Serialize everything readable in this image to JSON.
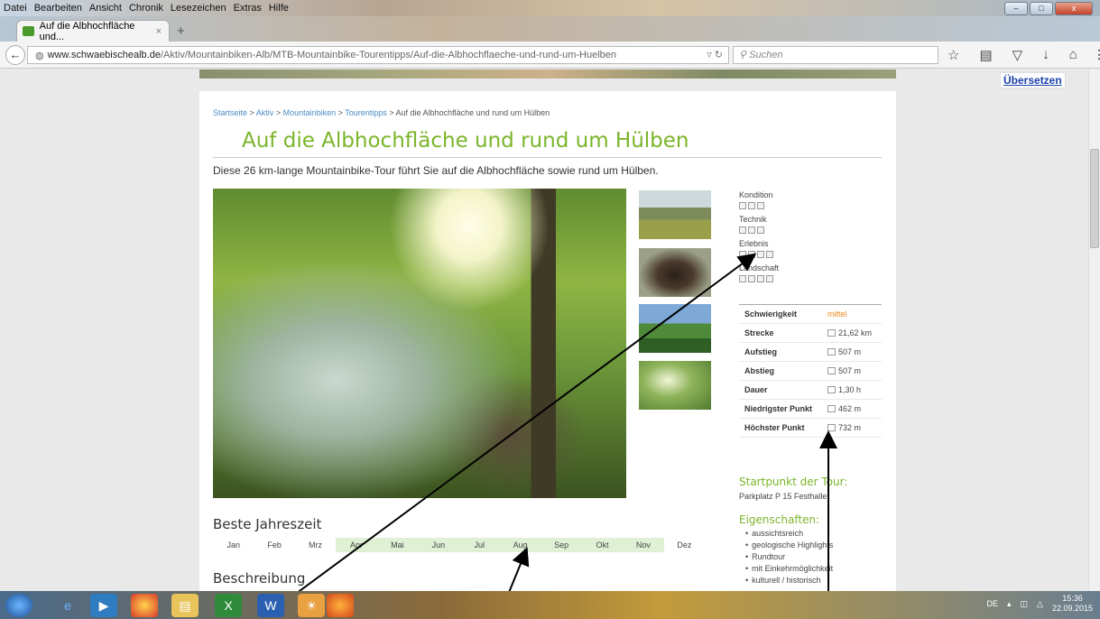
{
  "menubar": {
    "items": [
      "Datei",
      "Bearbeiten",
      "Ansicht",
      "Chronik",
      "Lesezeichen",
      "Extras",
      "Hilfe"
    ]
  },
  "window_controls": {
    "minimize": "–",
    "maximize": "□",
    "close": "x"
  },
  "tab": {
    "title": "Auf die Albhochfläche und...",
    "close": "×",
    "new_tab": "+"
  },
  "navbar": {
    "url_domain": "www.schwaebischealb.de",
    "url_path": "/Aktiv/Mountainbiken-Alb/MTB-Mountainbike-Tourentipps/Auf-die-Albhochflaeche-und-rund-um-Huelben",
    "search_placeholder": "Suchen"
  },
  "translate": {
    "label": "Übersetzen"
  },
  "breadcrumb": {
    "items": [
      "Startseite",
      "Aktiv",
      "Mountainbiken",
      "Tourentipps"
    ],
    "current": "Auf die Albhochfläche und rund um Hülben"
  },
  "page": {
    "title": "Auf die Albhochfläche und rund um Hülben",
    "subtitle": "Diese 26 km-lange Mountainbike-Tour führt Sie auf die Albhochfläche sowie rund um Hülben."
  },
  "ratings": [
    {
      "label": "Kondition",
      "boxes": 3
    },
    {
      "label": "Technik",
      "boxes": 3
    },
    {
      "label": "Erlebnis",
      "boxes": 4
    },
    {
      "label": "Landschaft",
      "boxes": 4
    }
  ],
  "facts": [
    {
      "key": "Schwierigkeit",
      "value": "mittel"
    },
    {
      "key": "Strecke",
      "value": "21,62 km"
    },
    {
      "key": "Aufstieg",
      "value": "507 m"
    },
    {
      "key": "Abstieg",
      "value": "507 m"
    },
    {
      "key": "Dauer",
      "value": "1,30 h"
    },
    {
      "key": "Niedrigster Punkt",
      "value": "462 m"
    },
    {
      "key": "Höchster Punkt",
      "value": "732 m"
    }
  ],
  "start": {
    "label": "Startpunkt der Tour:",
    "value": "Parkplatz P 15 Festhalle"
  },
  "properties": {
    "label": "Eigenschaften:",
    "items": [
      "aussichtsreich",
      "geologische Highlights",
      "Rundtour",
      "mit Einkehrmöglichkeit",
      "kulturell / historisch"
    ]
  },
  "season": {
    "label": "Beste Jahreszeit",
    "months": [
      "Jan",
      "Feb",
      "Mrz",
      "Apr",
      "Mai",
      "Jun",
      "Jul",
      "Aug",
      "Sep",
      "Okt",
      "Nov",
      "Dez"
    ],
    "active": [
      false,
      false,
      false,
      true,
      true,
      true,
      true,
      true,
      true,
      true,
      true,
      false
    ]
  },
  "description": {
    "label": "Beschreibung"
  },
  "taskbar": {
    "lang": "DE",
    "time": "15:36",
    "date": "22.09.2015"
  },
  "colors": {
    "accent": "#7ab52a",
    "link": "#4a8bc4",
    "difficulty": "#e88a1a",
    "season_bg": "#dff0d4"
  }
}
